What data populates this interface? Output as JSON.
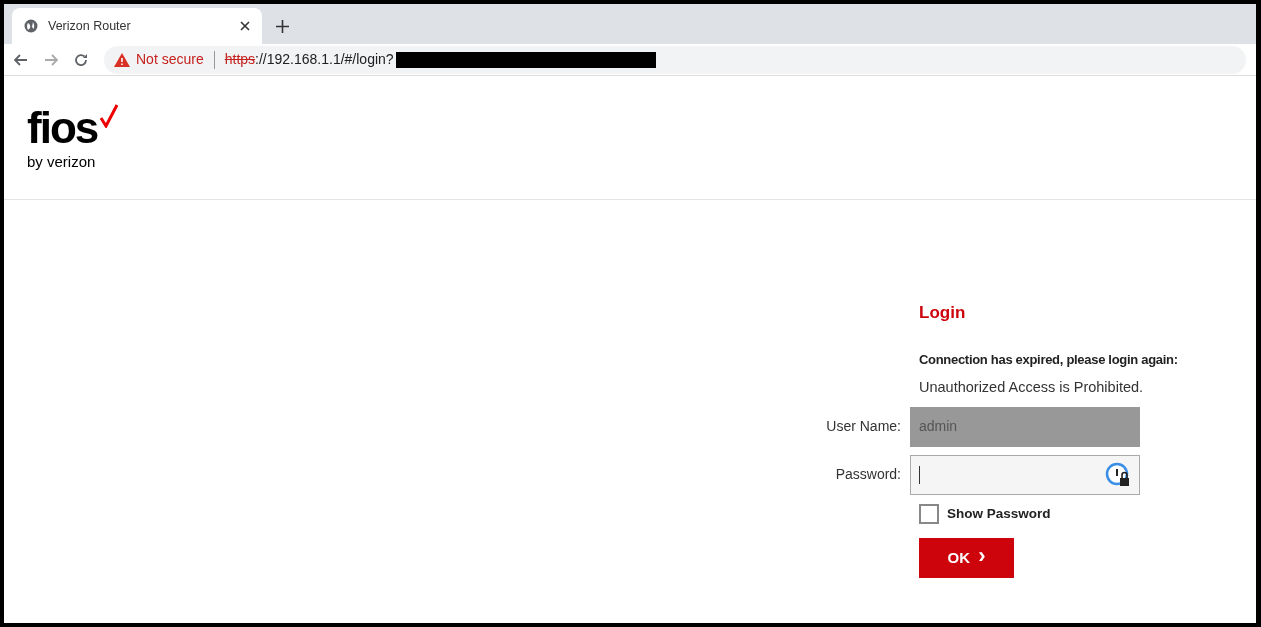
{
  "browser": {
    "tab": {
      "title": "Verizon Router",
      "selected": true
    },
    "security": "Not secure",
    "url": {
      "scheme": "https",
      "rest": "://192.168.1.1/#/login?"
    },
    "redacted": true
  },
  "logo": {
    "wordmark": "fios",
    "tagline": "by verizon"
  },
  "login": {
    "title": "Login",
    "message": "Connection has expired, please login again:",
    "notice": "Unauthorized Access is Prohibited.",
    "fields": [
      {
        "label": "User Name:",
        "value": "admin",
        "disabled": true,
        "kind": "text"
      },
      {
        "label": "Password:",
        "disabled": false,
        "kind": "password"
      }
    ],
    "show_password": {
      "label": "Show Password",
      "checked": false
    },
    "button": {
      "label": "OK",
      "chevron": "›"
    }
  }
}
